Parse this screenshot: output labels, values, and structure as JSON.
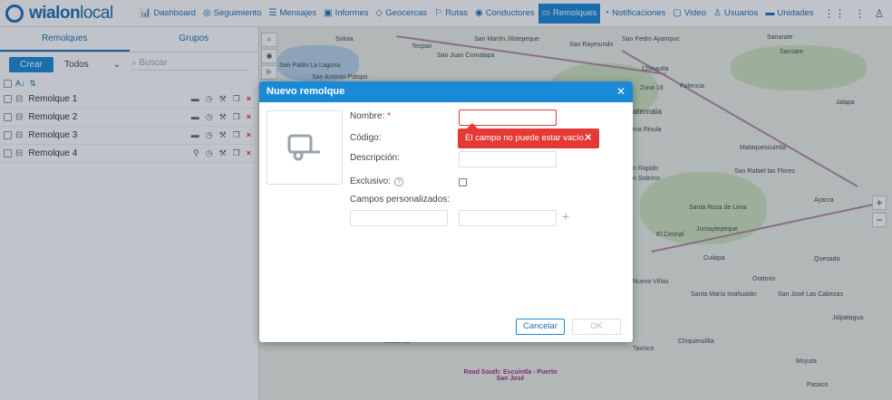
{
  "app": {
    "logo_main": "wialon",
    "logo_sub": "local"
  },
  "nav": [
    {
      "icon": "chart-icon",
      "glyph": "📊",
      "label": "Dashboard"
    },
    {
      "icon": "tracking-icon",
      "glyph": "◎",
      "label": "Seguimiento"
    },
    {
      "icon": "messages-icon",
      "glyph": "☰",
      "label": "Mensajes"
    },
    {
      "icon": "reports-icon",
      "glyph": "▣",
      "label": "Informes"
    },
    {
      "icon": "geofence-icon",
      "glyph": "◇",
      "label": "Geocercas"
    },
    {
      "icon": "routes-icon",
      "glyph": "⚐",
      "label": "Rutas"
    },
    {
      "icon": "drivers-icon",
      "glyph": "◉",
      "label": "Conductores"
    },
    {
      "icon": "trailers-icon",
      "glyph": "▭",
      "label": "Remolques"
    },
    {
      "icon": "notifications-icon",
      "glyph": "◔",
      "label": "Notificaciones"
    },
    {
      "icon": "video-icon",
      "glyph": "▢",
      "label": "Video"
    },
    {
      "icon": "users-icon",
      "glyph": "♙",
      "label": "Usuarios"
    },
    {
      "icon": "units-icon",
      "glyph": "▬",
      "label": "Unidades"
    }
  ],
  "left": {
    "tabs": [
      "Remolques",
      "Grupos"
    ],
    "create_label": "Crear",
    "filter_value": "Todos",
    "search_placeholder": "Buscar",
    "rows": [
      "Remolque 1",
      "Remolque 2",
      "Remolque 3",
      "Remolque 4"
    ]
  },
  "map": {
    "labels": [
      "Soloia",
      "Tecpan",
      "San Martín Jilotepeque",
      "San Raymundo",
      "San Pedro Ayampuc",
      "San Juan Comalapa",
      "Sanarate",
      "Sansare",
      "San Pablo La Laguna",
      "San Antonio Palopó",
      "Chinautla",
      "Zona 18",
      "Palencia",
      "Jalapa",
      "atemala",
      "ma Rinula",
      "Mataquescuintla",
      "n Rapido",
      "n Sobrino",
      "San Rafael las Flores",
      "Ayarza",
      "Santa Rosa de Lima",
      "Jumaytepeque",
      "El Cerinal",
      "Cuilapa",
      "Quesada",
      "Nuevo Viñas",
      "Oratorio",
      "Santa María Ixtahuatán",
      "San José Las Cabezas",
      "Jalpatagua",
      "Chiquimulilla",
      "Taxisco",
      "Moyuta",
      "Pasaco",
      "Escuintla",
      "Road South: Escuintla - Puerto San José"
    ]
  },
  "dialog": {
    "title": "Nuevo remolque",
    "name_label": "Nombre:",
    "required_mark": "*",
    "code_label": "Código:",
    "description_label": "Descripción:",
    "exclusive_label": "Exclusivo:",
    "custom_fields_label": "Campos personalizados:",
    "error_message": "El campo no puede estar vacío.",
    "cancel_label": "Cancelar",
    "ok_label": "OK"
  }
}
